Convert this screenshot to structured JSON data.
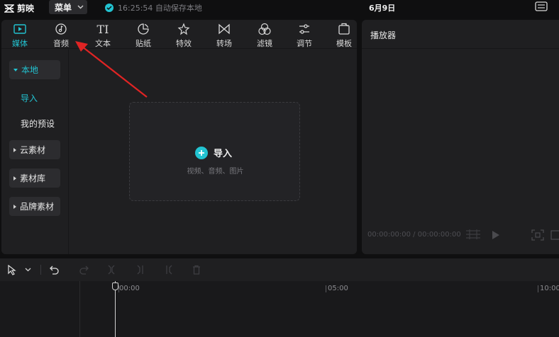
{
  "app": {
    "name": "剪映"
  },
  "titlebar": {
    "menu_label": "菜单",
    "save_status": "16:25:54 自动保存本地",
    "date": "6月9日"
  },
  "toolbar": {
    "tools": [
      {
        "label": "媒体",
        "icon": "media-icon"
      },
      {
        "label": "音频",
        "icon": "audio-icon"
      },
      {
        "label": "文本",
        "icon": "text-icon"
      },
      {
        "label": "贴纸",
        "icon": "sticker-icon"
      },
      {
        "label": "特效",
        "icon": "effects-icon"
      },
      {
        "label": "转场",
        "icon": "transition-icon"
      },
      {
        "label": "滤镜",
        "icon": "filter-icon"
      },
      {
        "label": "调节",
        "icon": "adjust-icon"
      },
      {
        "label": "模板",
        "icon": "template-icon"
      }
    ],
    "text_glyph": "TI"
  },
  "sidebar": {
    "local": "本地",
    "import": "导入",
    "presets": "我的预设",
    "cloud": "云素材",
    "library": "素材库",
    "brand": "品牌素材"
  },
  "import_area": {
    "label": "导入",
    "hint": "视频、音频、图片"
  },
  "player": {
    "title": "播放器",
    "timecode": "00:00:00:00 / 00:00:00:00"
  },
  "timeline": {
    "ruler": [
      "00:00",
      "05:00",
      "10:00"
    ]
  },
  "colors": {
    "accent": "#22c3d1",
    "arrow": "#e02424"
  }
}
